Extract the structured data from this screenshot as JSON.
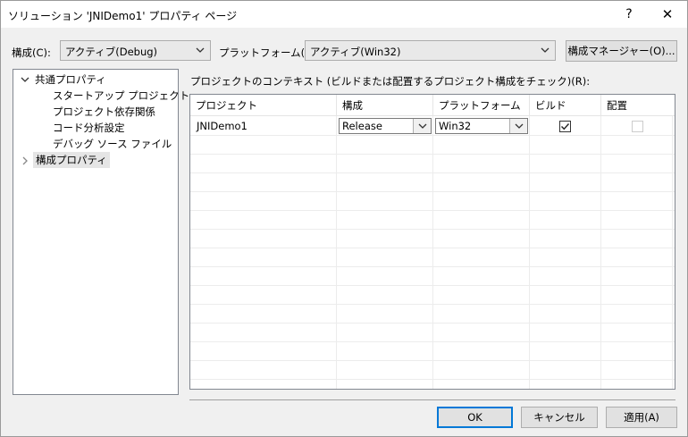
{
  "window": {
    "title": "ソリューション 'JNIDemo1' プロパティ ページ",
    "help_glyph": "?",
    "close_glyph": "✕"
  },
  "toolbar": {
    "config_label": "構成(C):",
    "config_value": "アクティブ(Debug)",
    "platform_label": "プラットフォーム(P):",
    "platform_value": "アクティブ(Win32)",
    "config_manager_button": "構成マネージャー(O)..."
  },
  "tree": {
    "items": [
      {
        "label": "共通プロパティ",
        "expanded": true
      },
      {
        "label": "スタートアップ プロジェクト"
      },
      {
        "label": "プロジェクト依存関係"
      },
      {
        "label": "コード分析設定"
      },
      {
        "label": "デバッグ ソース ファイル"
      },
      {
        "label": "構成プロパティ",
        "expanded": false,
        "selected": true
      }
    ]
  },
  "context": {
    "label": "プロジェクトのコンテキスト (ビルドまたは配置するプロジェクト構成をチェック)(R):",
    "columns": [
      "プロジェクト",
      "構成",
      "プラットフォーム",
      "ビルド",
      "配置"
    ],
    "rows": [
      {
        "project": "JNIDemo1",
        "config": "Release",
        "platform": "Win32",
        "build": true,
        "deploy": false
      }
    ]
  },
  "buttons": {
    "ok": "OK",
    "cancel": "キャンセル",
    "apply": "適用(A)"
  },
  "icons": {
    "expand_open": "chevron-down-icon",
    "expand_closed": "chevron-right-icon",
    "dropdown": "chevron-down-icon",
    "check": "check-icon"
  },
  "colors": {
    "accent": "#0078d7",
    "dialog_bg": "#f0f0f0",
    "selection": "#e5e5e5"
  }
}
